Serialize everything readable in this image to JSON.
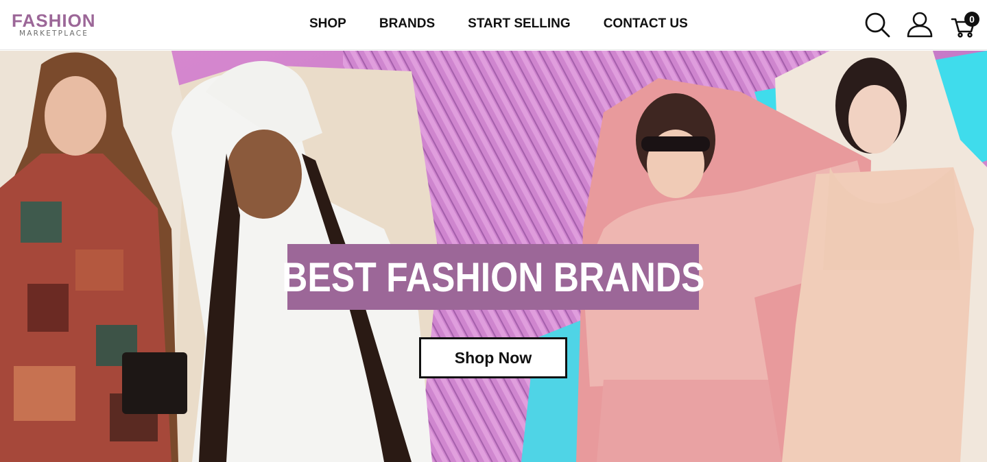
{
  "logo": {
    "main": "FASHION",
    "sub": "MARKETPLACE"
  },
  "nav": {
    "items": [
      {
        "label": "SHOP"
      },
      {
        "label": "BRANDS"
      },
      {
        "label": "START SELLING"
      },
      {
        "label": "CONTACT US"
      }
    ]
  },
  "cart": {
    "count": "0"
  },
  "icons": {
    "search": "search-icon",
    "account": "user-icon",
    "cart": "cart-icon"
  },
  "hero": {
    "title": "BEST FASHION BRANDS",
    "cta": "Shop Now"
  },
  "colors": {
    "brand": "#9c6798",
    "accent_pink": "#e28fcf",
    "accent_cyan": "#3fdcec",
    "text": "#111111"
  }
}
